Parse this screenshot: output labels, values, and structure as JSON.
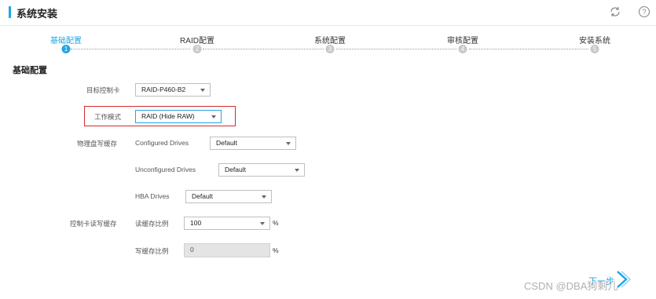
{
  "header": {
    "title": "系统安装",
    "refresh_icon": "refresh-icon",
    "help_icon": "help-icon"
  },
  "steps": [
    {
      "label": "基础配置",
      "number": "1",
      "active": true
    },
    {
      "label": "RAID配置",
      "number": "2",
      "active": false
    },
    {
      "label": "系统配置",
      "number": "3",
      "active": false
    },
    {
      "label": "审核配置",
      "number": "4",
      "active": false
    },
    {
      "label": "安装系统",
      "number": "5",
      "active": false
    }
  ],
  "section_title": "基础配置",
  "form": {
    "target_controller": {
      "label": "目标控制卡",
      "value": "RAID-P460-B2"
    },
    "work_mode": {
      "label": "工作模式",
      "value": "RAID (Hide RAW)"
    },
    "disk_cache": {
      "label": "物理盘写缓存",
      "configured_drives": {
        "label": "Configured Drives",
        "value": "Default"
      },
      "unconfigured_drives": {
        "label": "Unconfigured Drives",
        "value": "Default"
      },
      "hba_drives": {
        "label": "HBA Drives",
        "value": "Default"
      }
    },
    "controller_cache": {
      "label": "控制卡读写缓存",
      "read_ratio": {
        "label": "读缓存比例",
        "value": "100",
        "unit": "%"
      },
      "write_ratio": {
        "label": "写缓存比例",
        "value": "0",
        "unit": "%"
      }
    }
  },
  "footer": {
    "next_label": "下一步",
    "next_icon": "chevron-right-icon"
  },
  "watermark": "CSDN @DBA狗剩儿",
  "colors": {
    "accent": "#21a6e6",
    "highlight_border": "#d42b2b"
  }
}
